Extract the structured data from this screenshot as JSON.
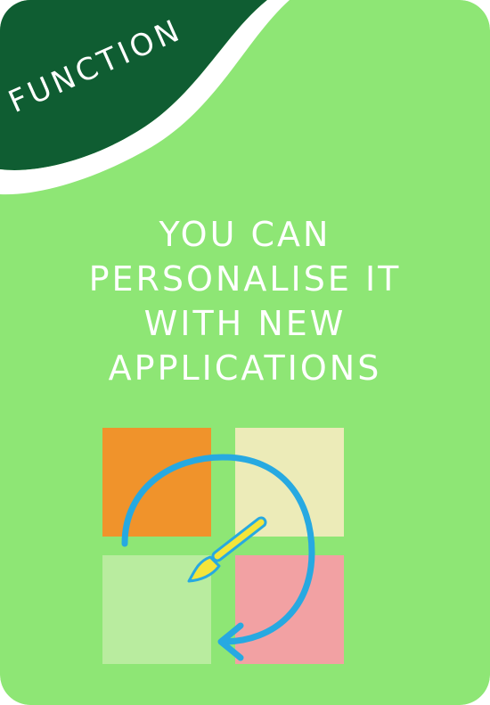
{
  "card": {
    "label": "FUNCTION",
    "headline_lines": [
      "YOU CAN",
      "PERSONALISE IT",
      "WITH NEW",
      "APPLICATIONS"
    ]
  },
  "colors": {
    "card_background": "#8ee675",
    "banner": "#0f5d32",
    "text": "#ffffff",
    "tile_orange": "#f0932b",
    "tile_cream": "#ecebb8",
    "tile_light_green": "#b9ec9f",
    "tile_pink": "#f2a1a3",
    "arrow": "#27a9e1",
    "brush_handle": "#f3e53a"
  },
  "icons": {
    "main": "apps-grid-with-paintbrush-icon"
  }
}
